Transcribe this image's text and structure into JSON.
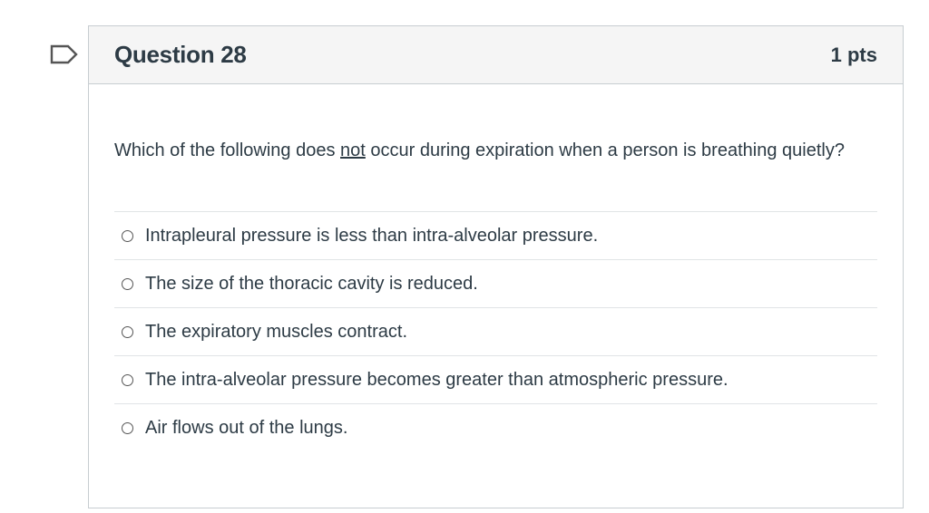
{
  "question": {
    "title": "Question 28",
    "points": "1 pts",
    "text_before": "Which of the following does ",
    "text_emphasis": "not",
    "text_after": " occur during expiration when a person is breathing quietly?"
  },
  "answers": [
    {
      "label": "Intrapleural pressure is less than intra-alveolar pressure."
    },
    {
      "label": "The size of the thoracic cavity is reduced."
    },
    {
      "label": "The expiratory muscles contract."
    },
    {
      "label": "The intra-alveolar pressure becomes greater than atmospheric pressure."
    },
    {
      "label": "Air flows out of the lungs."
    }
  ],
  "icons": {
    "flag": "flag-icon"
  },
  "colors": {
    "text": "#2d3b45",
    "border": "#c7cdd1",
    "header_bg": "#f5f5f5",
    "divider": "#e1e4e6"
  }
}
